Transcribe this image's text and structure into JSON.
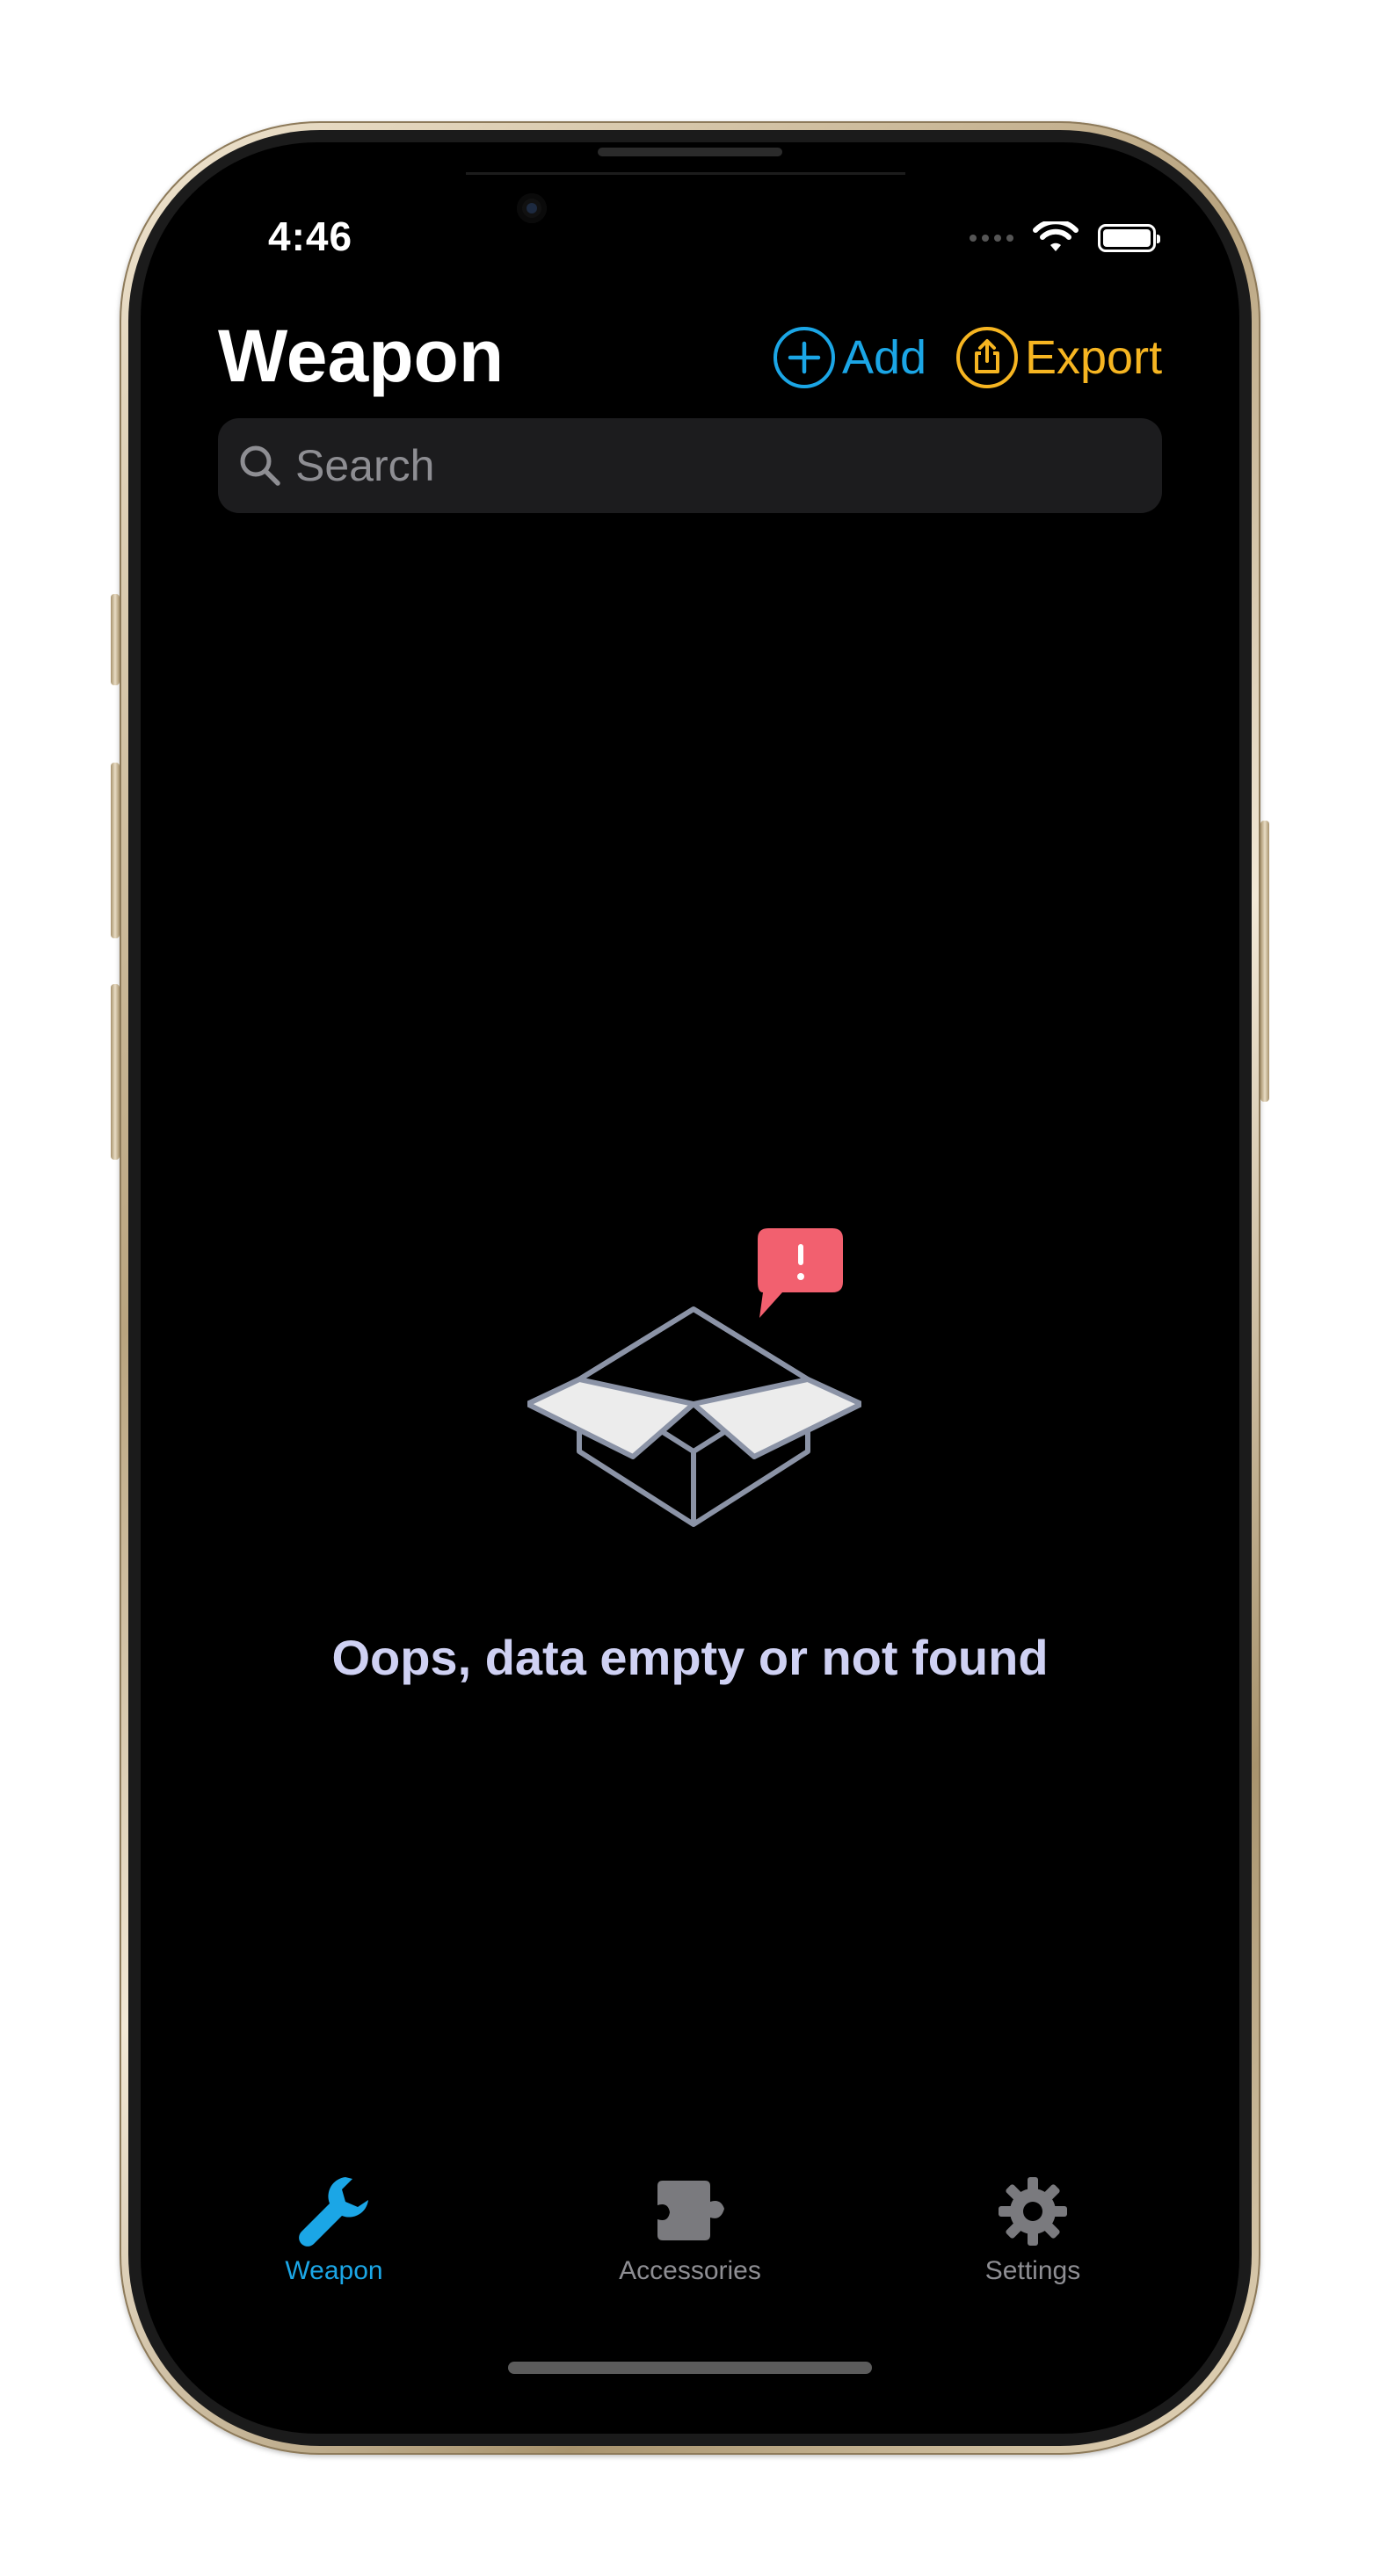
{
  "status_bar": {
    "time": "4:46"
  },
  "header": {
    "title": "Weapon",
    "add_label": "Add",
    "export_label": "Export"
  },
  "search": {
    "placeholder": "Search",
    "value": ""
  },
  "empty_state": {
    "message": "Oops, data empty or not found"
  },
  "tabbar": {
    "tabs": [
      {
        "label": "Weapon",
        "icon": "wrench-icon",
        "selected": true
      },
      {
        "label": "Accessories",
        "icon": "puzzle-piece-icon",
        "selected": false
      },
      {
        "label": "Settings",
        "icon": "gear-icon",
        "selected": false
      }
    ]
  },
  "colors": {
    "accent": "#1ba6e6",
    "export": "#f6b521",
    "background": "#000000",
    "search_field": "#1c1c1e",
    "empty_text": "#cfd1f3",
    "alert_badge": "#f2606f",
    "inactive_tab": "#8e8e93"
  }
}
